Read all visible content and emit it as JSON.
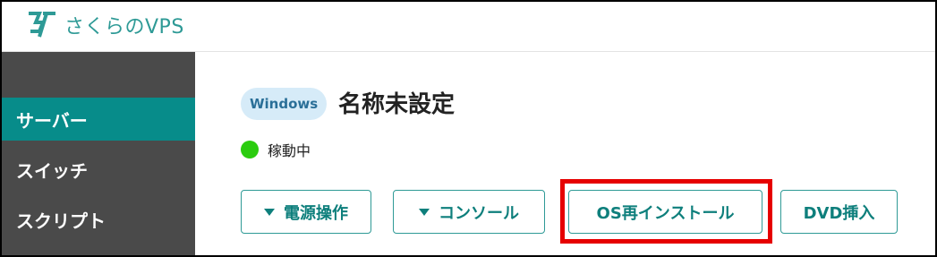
{
  "header": {
    "logo_text": "さくらのVPS"
  },
  "sidebar": {
    "items": [
      {
        "label": "サーバー"
      },
      {
        "label": "スイッチ"
      },
      {
        "label": "スクリプト"
      }
    ]
  },
  "server": {
    "os_badge": "Windows",
    "name": "名称未設定",
    "status": "稼動中"
  },
  "actions": {
    "power": "電源操作",
    "console": "コンソール",
    "reinstall": "OS再インストール",
    "dvd": "DVD挿入"
  },
  "colors": {
    "accent": "#078c8a",
    "status_green": "#2bcc0f",
    "highlight_red": "#e60000"
  }
}
